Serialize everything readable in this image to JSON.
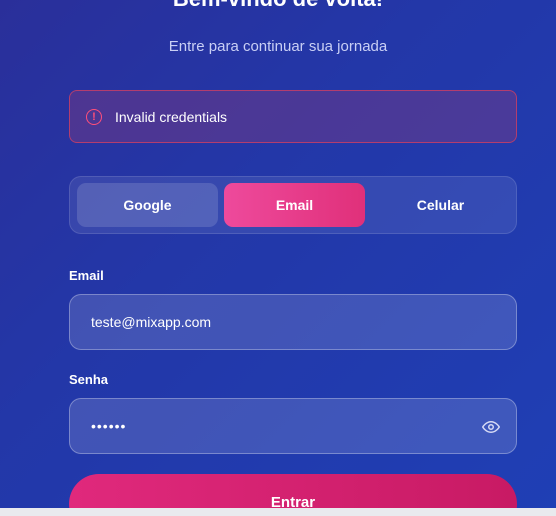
{
  "header": {
    "title": "Bem-vindo de volta!",
    "subtitle": "Entre para continuar sua jornada"
  },
  "alert": {
    "message": "Invalid credentials",
    "icon": "alert-circle-icon"
  },
  "tabs": [
    {
      "label": "Google",
      "active": false
    },
    {
      "label": "Email",
      "active": true
    },
    {
      "label": "Celular",
      "active": false
    }
  ],
  "form": {
    "email_label": "Email",
    "email_value": "teste@mixapp.com",
    "password_label": "Senha",
    "password_value": "••••••",
    "submit_label": "Entrar"
  },
  "colors": {
    "accent": "#e0307a",
    "error": "#ff4f7a",
    "background": "#2337a8"
  }
}
